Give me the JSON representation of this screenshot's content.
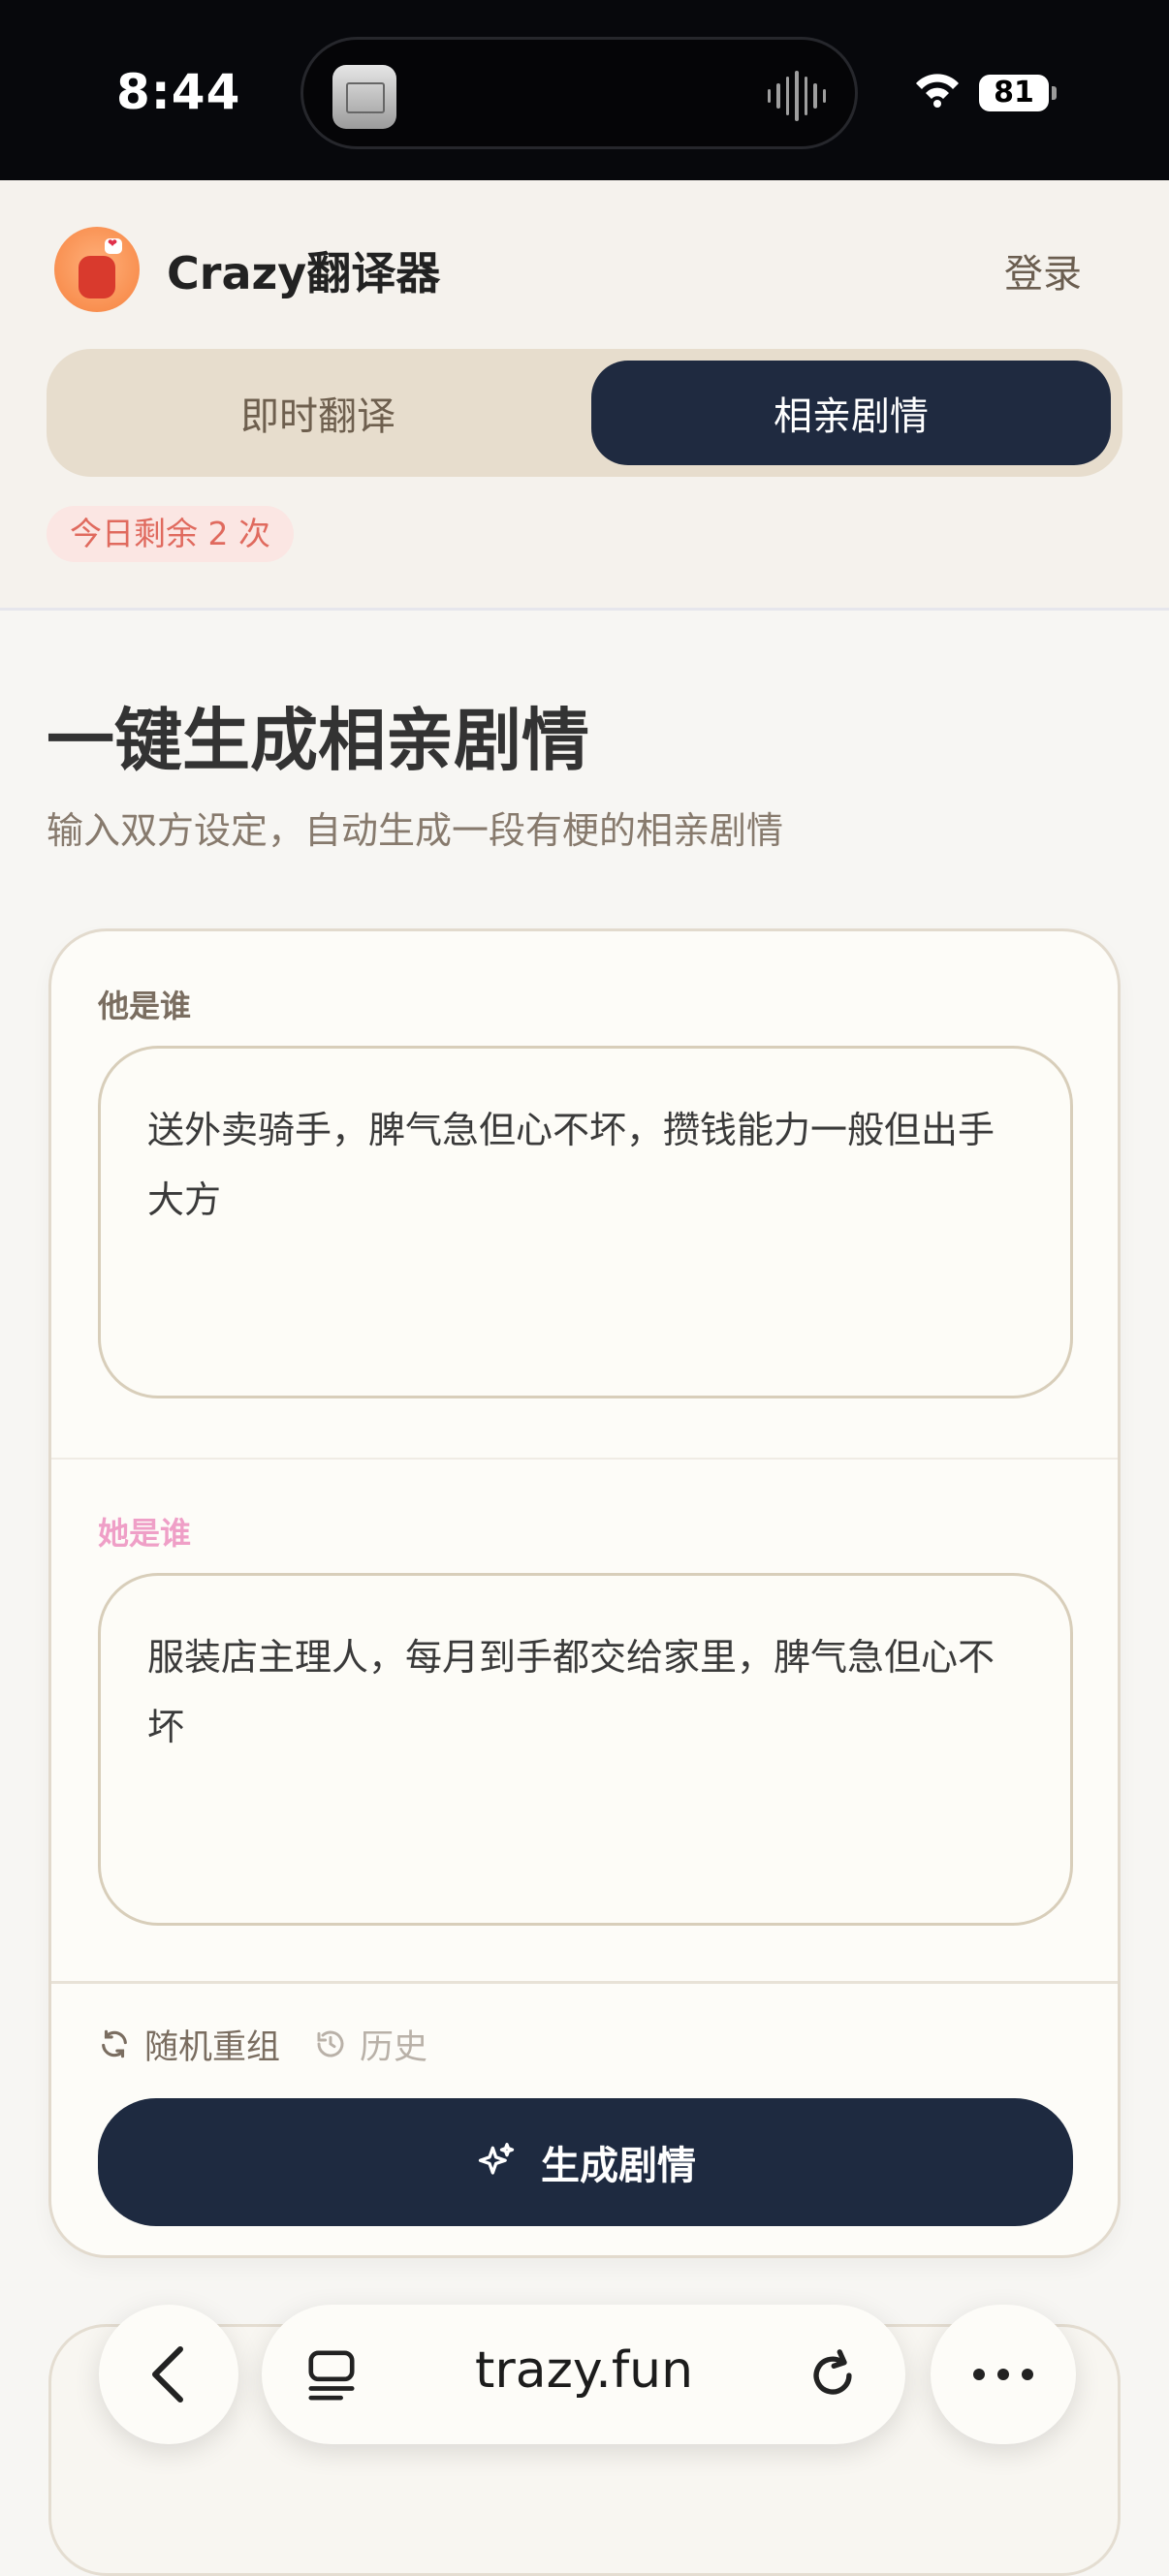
{
  "status_bar": {
    "time": "8:44",
    "battery": "81"
  },
  "header": {
    "app_name": "Crazy翻译器",
    "login_label": "登录",
    "tabs": [
      {
        "label": "即时翻译",
        "active": false
      },
      {
        "label": "相亲剧情",
        "active": true
      }
    ],
    "remaining_badge": "今日剩余 2 次"
  },
  "hero": {
    "title": "一键生成相亲剧情",
    "subtitle": "输入双方设定，自动生成一段有梗的相亲剧情"
  },
  "form": {
    "he_label": "他是谁",
    "he_value": "送外卖骑手，脾气急但心不坏，攒钱能力一般但出手大方",
    "she_label": "她是谁",
    "she_value": "服装店主理人，每月到手都交给家里，脾气急但心不坏",
    "random_label": "随机重组",
    "history_label": "历史",
    "generate_label": "生成剧情"
  },
  "browser": {
    "url": "trazy.fun"
  },
  "colors": {
    "primary_dark": "#1f2a40",
    "accent_pink": "#ef9fc7",
    "badge_text": "#e06a5e"
  },
  "icons": [
    "wifi-icon",
    "battery-icon",
    "refresh-icon",
    "history-icon",
    "sparkle-icon",
    "back-icon",
    "tabs-icon",
    "reload-icon",
    "more-icon"
  ]
}
